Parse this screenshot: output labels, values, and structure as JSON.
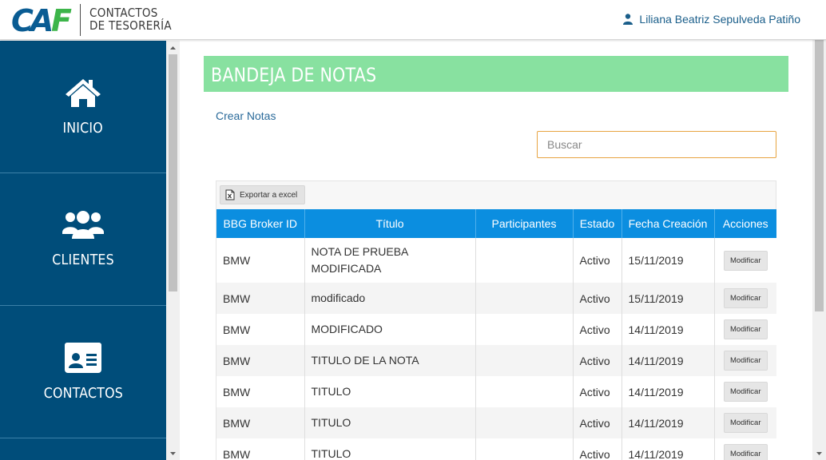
{
  "header": {
    "logo_text": "CAF",
    "brand_line1": "CONTACTOS",
    "brand_line2": "DE TESORERÍA",
    "user_icon": "user-icon",
    "user_name": "Liliana Beatriz Sepulveda Patiño"
  },
  "sidebar": {
    "items": [
      {
        "label": "INICIO",
        "icon": "home-icon"
      },
      {
        "label": "CLIENTES",
        "icon": "users-icon"
      },
      {
        "label": "CONTACTOS",
        "icon": "contact-card-icon"
      }
    ]
  },
  "main": {
    "title": "BANDEJA DE NOTAS",
    "create_link": "Crear Notas",
    "search_placeholder": "Buscar",
    "export_label": "Exportar a excel",
    "export_icon": "excel-icon",
    "columns": [
      "BBG Broker ID",
      "Título",
      "Participantes",
      "Estado",
      "Fecha Creación",
      "Acciones"
    ],
    "rows": [
      {
        "broker": "BMW",
        "titulo": "NOTA DE PRUEBA MODIFICADA",
        "participantes": "",
        "estado": "Activo",
        "fecha": "15/11/2019",
        "accion": "Modificar"
      },
      {
        "broker": "BMW",
        "titulo": "modificado",
        "participantes": "",
        "estado": "Activo",
        "fecha": "15/11/2019",
        "accion": "Modificar"
      },
      {
        "broker": "BMW",
        "titulo": "MODIFICADO",
        "participantes": "",
        "estado": "Activo",
        "fecha": "14/11/2019",
        "accion": "Modificar"
      },
      {
        "broker": "BMW",
        "titulo": "TITULO DE LA NOTA",
        "participantes": "",
        "estado": "Activo",
        "fecha": "14/11/2019",
        "accion": "Modificar"
      },
      {
        "broker": "BMW",
        "titulo": "TITULO",
        "participantes": "",
        "estado": "Activo",
        "fecha": "14/11/2019",
        "accion": "Modificar"
      },
      {
        "broker": "BMW",
        "titulo": "TITULO",
        "participantes": "",
        "estado": "Activo",
        "fecha": "14/11/2019",
        "accion": "Modificar"
      },
      {
        "broker": "BMW",
        "titulo": "TITULO",
        "participantes": "",
        "estado": "Activo",
        "fecha": "14/11/2019",
        "accion": "Modificar"
      }
    ]
  },
  "colors": {
    "sidebar_bg": "#004d7a",
    "title_bar": "#88e1a0",
    "table_header": "#0b8ee0",
    "search_border": "#e7a441",
    "logo_blue": "#0a5c93",
    "logo_green": "#3db54a",
    "link": "#2a6a9a"
  }
}
